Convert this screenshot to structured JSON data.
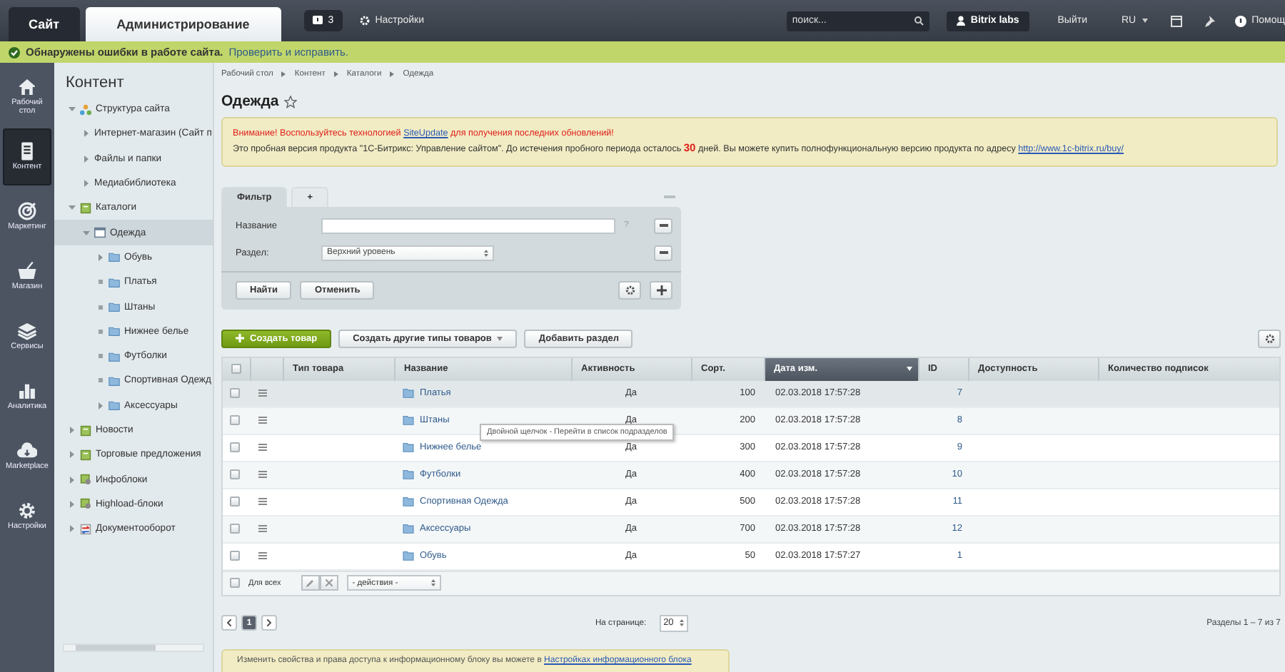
{
  "top_bar": {
    "tabs": [
      {
        "label": "Сайт",
        "selected": false
      },
      {
        "label": "Администрирование",
        "selected": true
      }
    ],
    "notifications": {
      "count": "3"
    },
    "settings": {
      "label": "Настройки"
    },
    "search": {
      "placeholder": "поиск..."
    },
    "user": {
      "label": "Bitrix labs"
    },
    "logout": {
      "label": "Выйти"
    },
    "language": {
      "label": "RU"
    },
    "help": {
      "label": "Помощ"
    }
  },
  "alert_bar": {
    "text": "Обнаружены ошибки в работе сайта.",
    "link": "Проверить и исправить."
  },
  "nav": [
    {
      "label": "Рабочий стол",
      "kind": "home",
      "selected": false
    },
    {
      "label": "Контент",
      "kind": "content",
      "selected": true
    },
    {
      "label": "Маркетинг",
      "kind": "marketing",
      "selected": false
    },
    {
      "label": "Магазин",
      "kind": "shop",
      "selected": false
    },
    {
      "label": "Сервисы",
      "kind": "services",
      "selected": false
    },
    {
      "label": "Аналитика",
      "kind": "analytics",
      "selected": false
    },
    {
      "label": "Marketplace",
      "kind": "marketplace",
      "selected": false
    },
    {
      "label": "Настройки",
      "kind": "settings",
      "selected": false
    }
  ],
  "tree": {
    "title": "Контент",
    "items": [
      {
        "label": "Структура сайта",
        "kind": "site",
        "expanded": true,
        "selected": false,
        "children": [
          {
            "label": "Интернет-магазин (Сайт п",
            "kind": "none",
            "expanded": false,
            "selected": false
          },
          {
            "label": "Файлы и папки",
            "kind": "none",
            "expanded": false,
            "selected": false
          },
          {
            "label": "Медиабиблиотека",
            "kind": "none",
            "expanded": false,
            "selected": false
          }
        ]
      },
      {
        "label": "Каталоги",
        "kind": "catalog",
        "expanded": true,
        "selected": false,
        "children": [
          {
            "label": "Одежда",
            "kind": "section",
            "expanded": true,
            "selected": true,
            "children": [
              {
                "label": "Обувь",
                "kind": "folder",
                "expanded": false,
                "selected": false
              },
              {
                "label": "Платья",
                "kind": "folder",
                "selected": false
              },
              {
                "label": "Штаны",
                "kind": "folder",
                "selected": false
              },
              {
                "label": "Нижнее белье",
                "kind": "folder",
                "selected": false
              },
              {
                "label": "Футболки",
                "kind": "folder",
                "selected": false
              },
              {
                "label": "Спортивная Одежд",
                "kind": "folder",
                "selected": false
              },
              {
                "label": "Аксессуары",
                "kind": "folder",
                "expanded": false,
                "selected": false
              }
            ]
          }
        ]
      },
      {
        "label": "Новости",
        "kind": "catalog",
        "expanded": false,
        "selected": false
      },
      {
        "label": "Торговые предложения",
        "kind": "catalog",
        "expanded": false,
        "selected": false
      },
      {
        "label": "Инфоблоки",
        "kind": "iblock",
        "expanded": false,
        "selected": false
      },
      {
        "label": "Highload-блоки",
        "kind": "iblock",
        "expanded": false,
        "selected": false
      },
      {
        "label": "Документооборот",
        "kind": "workflow",
        "expanded": false,
        "selected": false
      }
    ]
  },
  "breadcrumbs": [
    "Рабочий стол",
    "Контент",
    "Каталоги",
    "Одежда"
  ],
  "page_title": {
    "text": "Одежда",
    "favorite": false
  },
  "notice": {
    "warning_before": "Внимание! Воспользуйтесь технологией ",
    "warning_link": "SiteUpdate",
    "warning_after": " для получения последних обновлений!",
    "trial_text": "Это пробная версия продукта \"1С-Битрикс: Управление сайтом\". До истечения пробного периода осталось **30** дней. Вы можете купить полнофункциональную версию продукта по адресу ",
    "trial_link": "http://www.1c-bitrix.ru/buy/"
  },
  "filter": {
    "tabs": [
      {
        "label": "Фильтр",
        "selected": true
      },
      {
        "label": "+",
        "selected": false
      }
    ],
    "fields": [
      {
        "label": "Название",
        "kind": "text",
        "help": "?"
      },
      {
        "label": "Раздел:",
        "kind": "select",
        "value": "Верхний уровень"
      }
    ],
    "buttons": [
      "Найти",
      "Отменить"
    ]
  },
  "toolbar": {
    "create": "Создать товар",
    "other_types": "Создать другие типы товаров",
    "add_section": "Добавить раздел"
  },
  "table": {
    "select_all": {
      "checked": false
    },
    "columns": [
      {
        "label": "Тип товара",
        "sorted": false
      },
      {
        "label": "Название",
        "sorted": false
      },
      {
        "label": "Активность",
        "sorted": false
      },
      {
        "label": "Сорт.",
        "sorted": false
      },
      {
        "label": "Дата изм.",
        "sorted": true
      },
      {
        "label": "ID",
        "sorted": false
      },
      {
        "label": "Доступность",
        "sorted": false
      },
      {
        "label": "Количество подписок",
        "sorted": false
      }
    ],
    "rows": [
      {
        "name": "Платья",
        "active": "Да",
        "sort": "100",
        "date": "02.03.2018 17:57:28",
        "id": "7",
        "highlighted": true,
        "checked": false
      },
      {
        "name": "Штаны",
        "active": "Да",
        "sort": "200",
        "date": "02.03.2018 17:57:28",
        "id": "8",
        "highlighted": false,
        "checked": false
      },
      {
        "name": "Нижнее белье",
        "active": "Да",
        "sort": "300",
        "date": "02.03.2018 17:57:28",
        "id": "9",
        "highlighted": false,
        "checked": false
      },
      {
        "name": "Футболки",
        "active": "Да",
        "sort": "400",
        "date": "02.03.2018 17:57:28",
        "id": "10",
        "highlighted": false,
        "checked": false
      },
      {
        "name": "Спортивная Одежда",
        "active": "Да",
        "sort": "500",
        "date": "02.03.2018 17:57:28",
        "id": "11",
        "highlighted": false,
        "checked": false
      },
      {
        "name": "Аксессуары",
        "active": "Да",
        "sort": "700",
        "date": "02.03.2018 17:57:28",
        "id": "12",
        "highlighted": false,
        "checked": false
      },
      {
        "name": "Обувь",
        "active": "Да",
        "sort": "50",
        "date": "02.03.2018 17:57:27",
        "id": "1",
        "highlighted": false,
        "checked": false
      }
    ],
    "footer": {
      "for_all_checked": false,
      "for_all": "Для всех",
      "actions": "- действия -"
    }
  },
  "tooltip": "Двойной щелчок - Перейти в список подразделов",
  "pagination": {
    "pages": [
      {
        "label": "1",
        "selected": true
      }
    ],
    "per_page_label": "На странице:",
    "per_page": "20",
    "summary": "Разделы 1 – 7 из 7"
  },
  "info": {
    "text": "Изменить свойства и права доступа к информационному блоку вы можете в ",
    "link": "Настройках информационного блока"
  }
}
